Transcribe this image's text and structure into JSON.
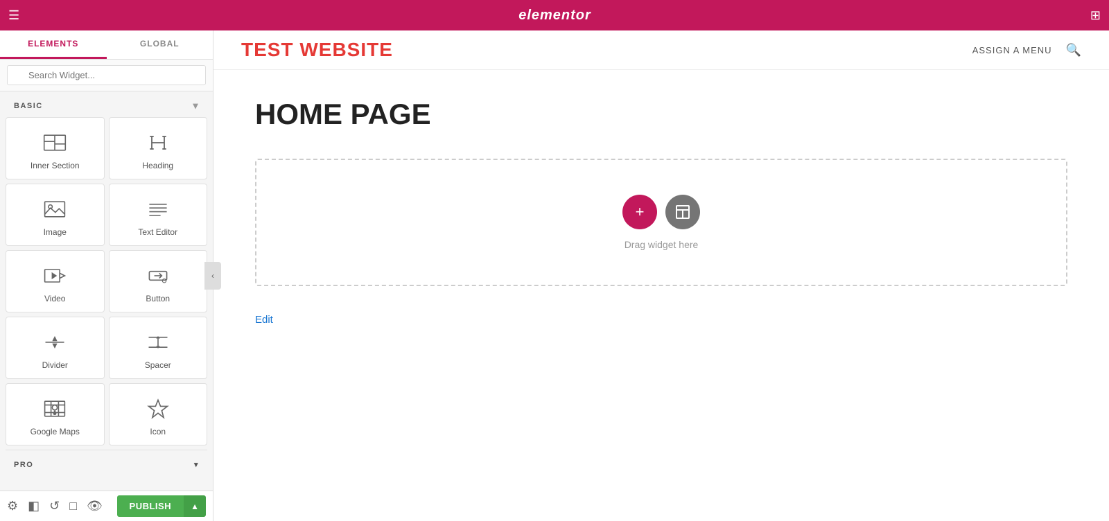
{
  "topbar": {
    "logo": "elementor",
    "hamburger_icon": "☰",
    "grid_icon": "⊞"
  },
  "sidebar": {
    "tabs": [
      {
        "label": "ELEMENTS",
        "active": true
      },
      {
        "label": "GLOBAL",
        "active": false
      }
    ],
    "search": {
      "placeholder": "Search Widget..."
    },
    "sections": {
      "basic": {
        "label": "BASIC",
        "chevron": "▾"
      },
      "pro": {
        "label": "PRO",
        "chevron": "▾"
      }
    },
    "widgets": [
      {
        "id": "inner-section",
        "label": "Inner Section"
      },
      {
        "id": "heading",
        "label": "Heading"
      },
      {
        "id": "image",
        "label": "Image"
      },
      {
        "id": "text-editor",
        "label": "Text Editor"
      },
      {
        "id": "video",
        "label": "Video"
      },
      {
        "id": "button",
        "label": "Button"
      },
      {
        "id": "divider",
        "label": "Divider"
      },
      {
        "id": "spacer",
        "label": "Spacer"
      },
      {
        "id": "google-maps",
        "label": "Google Maps"
      },
      {
        "id": "icon",
        "label": "Icon"
      }
    ]
  },
  "bottom_toolbar": {
    "settings_icon": "⚙",
    "layers_icon": "◧",
    "history_icon": "↺",
    "responsive_icon": "□",
    "preview_icon": "👁",
    "publish_label": "PUBLISH",
    "publish_dropdown_icon": "▲"
  },
  "canvas": {
    "site_title": "TEST WEBSITE",
    "assign_menu": "ASSIGN A MENU",
    "page_heading": "HOME PAGE",
    "drag_hint": "Drag widget here",
    "edit_link": "Edit"
  }
}
